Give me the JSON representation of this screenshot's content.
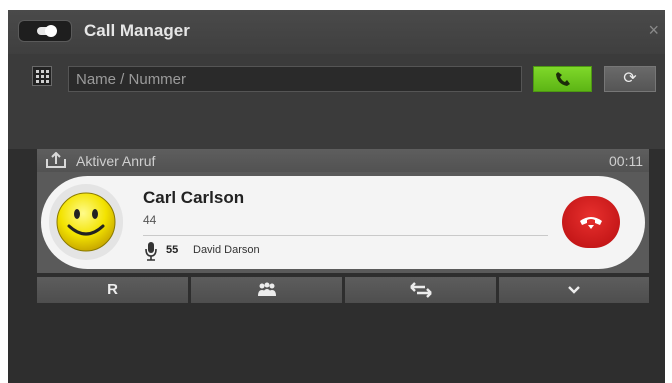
{
  "window": {
    "title": "Call Manager",
    "close_label": "×"
  },
  "toolbar": {
    "search_placeholder": "Name / Nummer",
    "refresh_label": "⟳"
  },
  "active_call": {
    "header_label": "Aktiver Anruf",
    "timer": "00:11",
    "caller_name": "Carl Carlson",
    "caller_number": "44",
    "sub_number": "55",
    "sub_name": "David Darson"
  },
  "actions": {
    "r_label": "R"
  },
  "colors": {
    "call_green": "#6cc41f",
    "hangup_red": "#d42020",
    "background": "#2e2e2e"
  },
  "icons": [
    "toggle-icon",
    "close-icon",
    "dialpad-icon",
    "phone-icon",
    "refresh-icon",
    "share-icon",
    "smiley-icon",
    "mic-icon",
    "hangup-icon",
    "conference-icon",
    "transfer-icon",
    "chevron-down-icon"
  ]
}
